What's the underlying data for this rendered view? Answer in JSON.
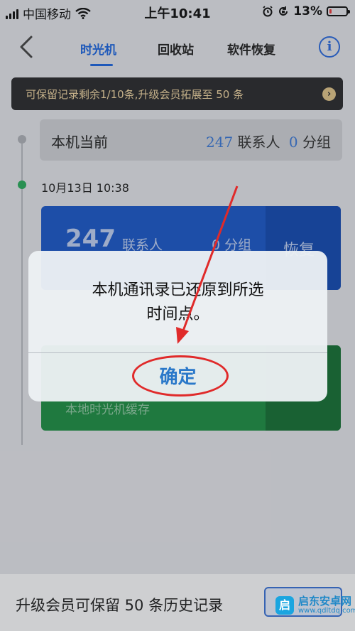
{
  "status_bar": {
    "carrier": "中国移动",
    "time": "上午10:41",
    "battery": "13%",
    "battery_level": 0.13
  },
  "nav": {
    "tabs": [
      {
        "label": "时光机",
        "active": true
      },
      {
        "label": "回收站",
        "active": false
      },
      {
        "label": "软件恢复",
        "active": false
      }
    ],
    "info_icon": "i"
  },
  "banner": {
    "text": "可保留记录剩余1/10条,升级会员拓展至 50 条",
    "arrow": "›"
  },
  "current": {
    "label": "本机当前",
    "contacts_count": "247",
    "contacts_unit": "联系人",
    "groups_count": "0",
    "groups_unit": "分组"
  },
  "entry": {
    "date": "10月13日  10:38",
    "contacts_count": "247",
    "contacts_unit": "联系人",
    "groups_text": "0 分组",
    "restore_label": "恢复"
  },
  "cache_card": {
    "label": "本地时光机缓存"
  },
  "dialog": {
    "line1": "本机通讯录已还原到所选",
    "line2": "时间点。",
    "confirm_label": "确定"
  },
  "bottom": {
    "text": "升级会员可保留 50 条历史记录"
  },
  "watermark": {
    "badge": "启",
    "title": "启东安卓网",
    "url": "www.qdltdq.com"
  },
  "colors": {
    "accent": "#1d63d8",
    "annotation": "#e02a2a",
    "confirm": "#2a78c9"
  }
}
